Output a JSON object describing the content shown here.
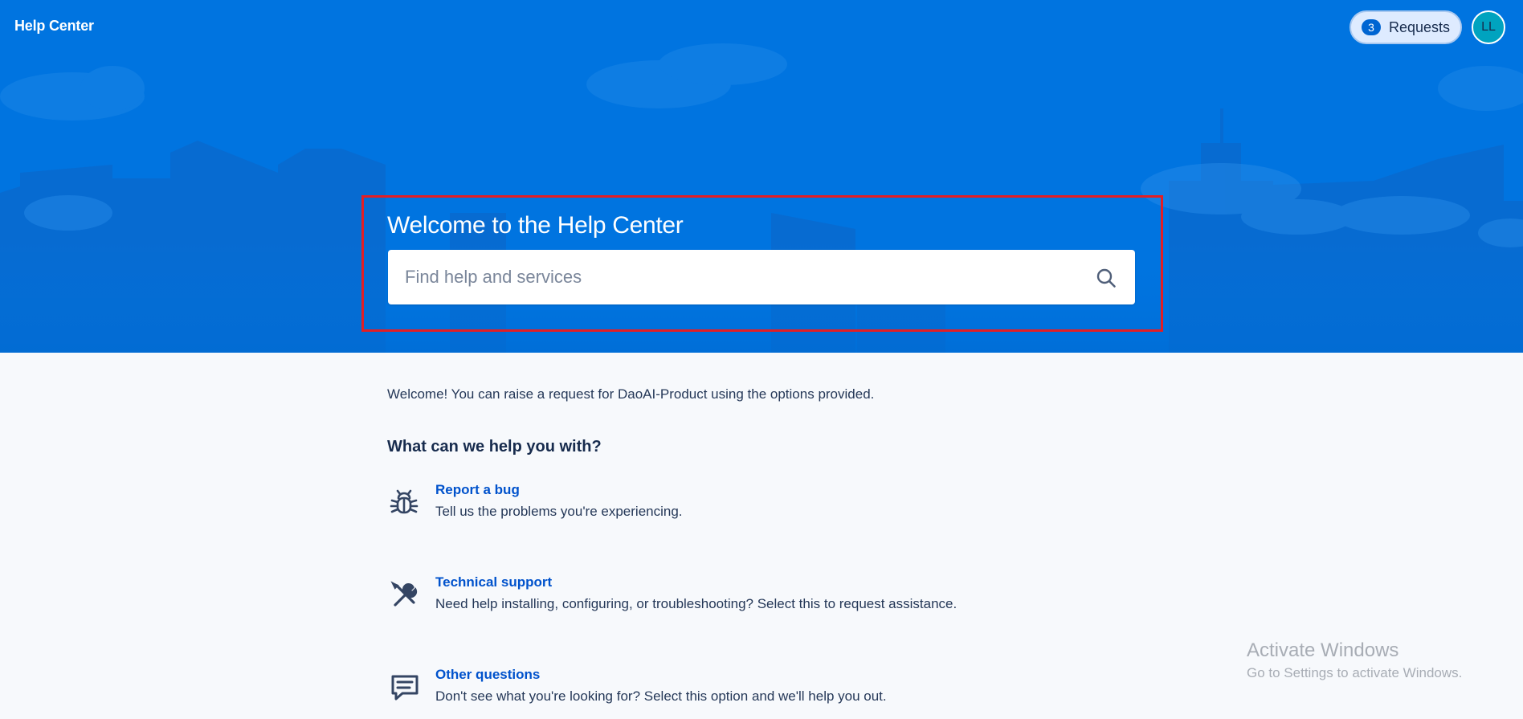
{
  "header": {
    "brand": "Help Center",
    "requests_count": "3",
    "requests_label": "Requests",
    "avatar_initials": "LL"
  },
  "hero": {
    "title": "Welcome to the Help Center",
    "search_placeholder": "Find help and services",
    "search_value": ""
  },
  "content": {
    "intro": "Welcome! You can raise a request for DaoAI-Product using the options provided.",
    "heading": "What can we help you with?",
    "options": [
      {
        "icon": "bug-icon",
        "title": "Report a bug",
        "description": "Tell us the problems you're experiencing."
      },
      {
        "icon": "tools-icon",
        "title": "Technical support",
        "description": "Need help installing, configuring, or troubleshooting? Select this to request assistance."
      },
      {
        "icon": "chat-icon",
        "title": "Other questions",
        "description": "Don't see what you're looking for? Select this option and we'll help you out."
      }
    ]
  },
  "watermark": {
    "title": "Activate Windows",
    "subtitle": "Go to Settings to activate Windows."
  },
  "colors": {
    "hero_background": "#0074e0",
    "link": "#0052cc",
    "highlight": "#e31e24",
    "avatar": "#00a3bf"
  }
}
